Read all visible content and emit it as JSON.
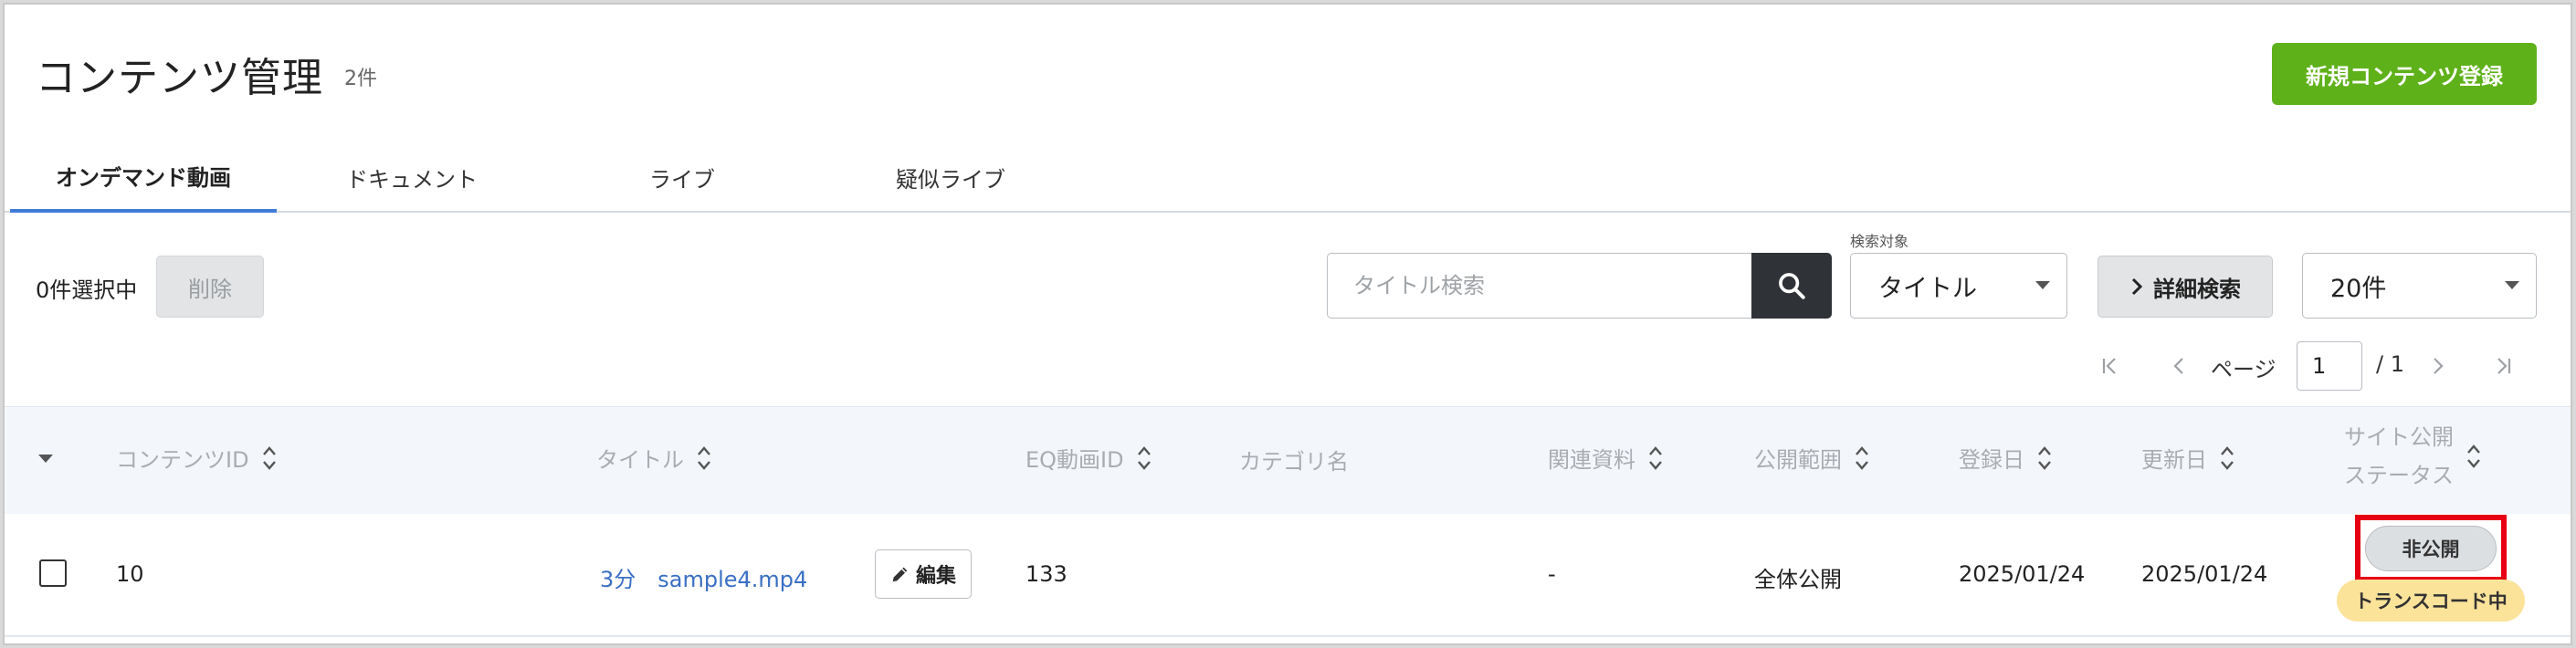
{
  "header": {
    "title": "コンテンツ管理",
    "count": "2件",
    "new_button": "新規コンテンツ登録"
  },
  "tabs": [
    {
      "label": "オンデマンド動画",
      "active": true
    },
    {
      "label": "ドキュメント",
      "active": false
    },
    {
      "label": "ライブ",
      "active": false
    },
    {
      "label": "疑似ライブ",
      "active": false
    }
  ],
  "toolbar": {
    "selected_count": "0件選択中",
    "delete_label": "削除",
    "search_placeholder": "タイトル検索",
    "search_target_label": "検索対象",
    "search_target_value": "タイトル",
    "advanced_search_label": "詳細検索",
    "page_size_value": "20件"
  },
  "pagination": {
    "page_label": "ページ",
    "current_page": "1",
    "total_pages": "/ 1"
  },
  "table": {
    "columns": {
      "content_id": "コンテンツID",
      "title": "タイトル",
      "eq_video_id": "EQ動画ID",
      "category": "カテゴリ名",
      "related_docs": "関連資料",
      "scope": "公開範囲",
      "registered": "登録日",
      "updated": "更新日",
      "site_status_line1": "サイト公開",
      "site_status_line2": "ステータス"
    },
    "rows": [
      {
        "content_id": "10",
        "title": "3分　sample4.mp4",
        "edit_label": "編集",
        "eq_video_id": "133",
        "category": "",
        "related_docs": "-",
        "scope": "全体公開",
        "registered": "2025/01/24",
        "updated": "2025/01/24",
        "status_badge": "非公開",
        "transcode_badge": "トランスコード中"
      }
    ]
  },
  "colors": {
    "primary_green": "#5fb11a",
    "active_tab_underline": "#3f7bd8",
    "link_blue": "#3a6fc4",
    "highlight_red": "#e60012",
    "transcode_badge_bg": "#fce39a",
    "search_button_bg": "#2f3337"
  },
  "icons": {
    "search": "search-icon",
    "advanced": "chevron-right-icon",
    "edit": "pencil-icon",
    "sort": "sort-icon",
    "collapse": "caret-down-icon",
    "first_page": "first-page-icon",
    "prev_page": "prev-page-icon",
    "next_page": "next-page-icon",
    "last_page": "last-page-icon"
  }
}
